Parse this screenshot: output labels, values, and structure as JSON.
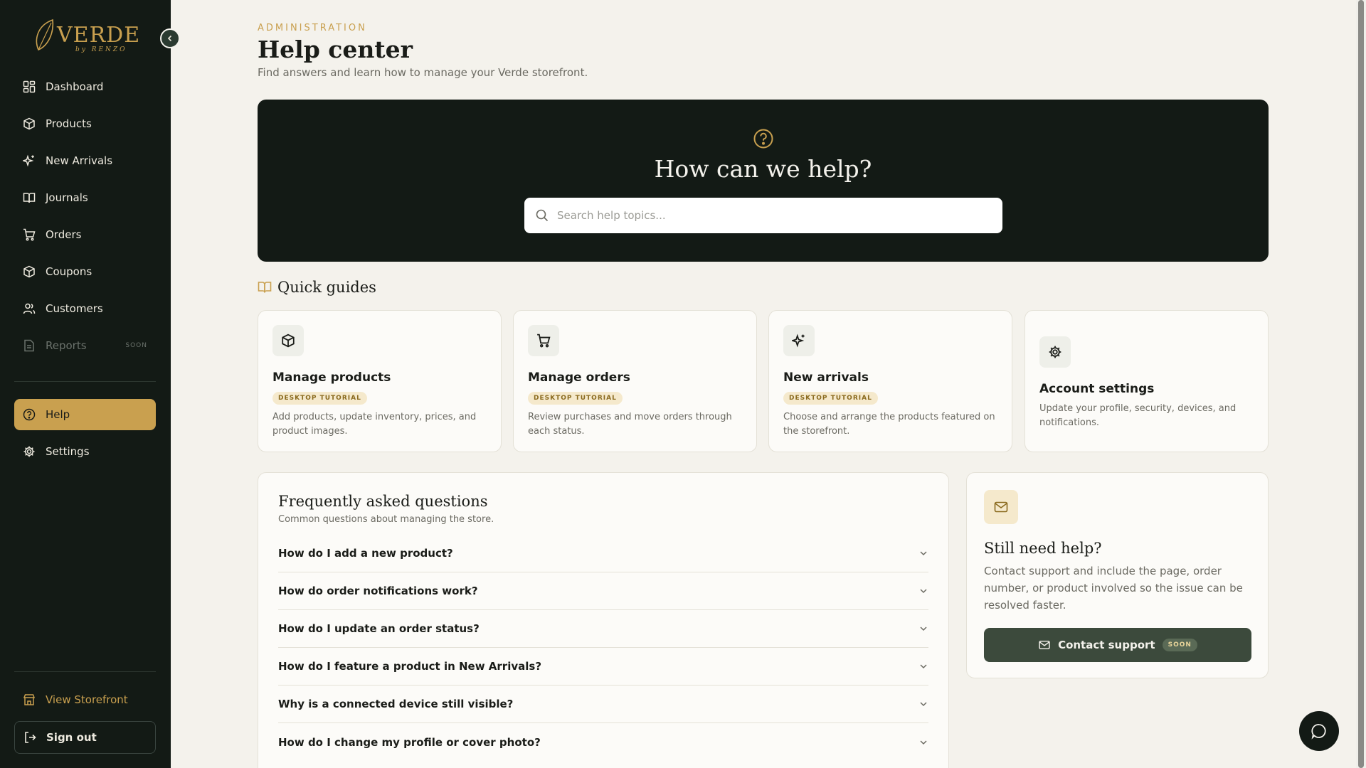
{
  "brand": {
    "name": "VERDE",
    "tagline": "by RENZO",
    "accent": "#c9a04f",
    "dark": "#131a15"
  },
  "sidebar": {
    "items": [
      {
        "label": "Dashboard",
        "icon": "dashboard-icon"
      },
      {
        "label": "Products",
        "icon": "box-icon"
      },
      {
        "label": "New Arrivals",
        "icon": "sparkle-icon"
      },
      {
        "label": "Journals",
        "icon": "book-icon"
      },
      {
        "label": "Orders",
        "icon": "cart-icon"
      },
      {
        "label": "Coupons",
        "icon": "coupon-icon"
      },
      {
        "label": "Customers",
        "icon": "users-icon"
      },
      {
        "label": "Reports",
        "icon": "report-icon",
        "badge": "SOON"
      }
    ],
    "secondary": [
      {
        "label": "Help",
        "icon": "help-icon",
        "active": true
      },
      {
        "label": "Settings",
        "icon": "gear-icon"
      }
    ],
    "view_storefront": "View Storefront",
    "sign_out": "Sign out"
  },
  "header": {
    "eyebrow": "ADMINISTRATION",
    "title": "Help center",
    "subtitle": "Find answers and learn how to manage your Verde storefront."
  },
  "hero": {
    "title": "How can we help?",
    "search_placeholder": "Search help topics..."
  },
  "quick_guides": {
    "title": "Quick guides",
    "cards": [
      {
        "title": "Manage products",
        "badge": "DESKTOP TUTORIAL",
        "desc": "Add products, update inventory, prices, and product images.",
        "icon": "box-icon"
      },
      {
        "title": "Manage orders",
        "badge": "DESKTOP TUTORIAL",
        "desc": "Review purchases and move orders through each status.",
        "icon": "cart-icon"
      },
      {
        "title": "New arrivals",
        "badge": "DESKTOP TUTORIAL",
        "desc": "Choose and arrange the products featured on the storefront.",
        "icon": "sparkle-icon"
      },
      {
        "title": "Account settings",
        "desc": "Update your profile, security, devices, and notifications.",
        "icon": "gear-icon"
      }
    ]
  },
  "faq": {
    "title": "Frequently asked questions",
    "subtitle": "Common questions about managing the store.",
    "items": [
      "How do I add a new product?",
      "How do order notifications work?",
      "How do I update an order status?",
      "How do I feature a product in New Arrivals?",
      "Why is a connected device still visible?",
      "How do I change my profile or cover photo?"
    ]
  },
  "support": {
    "title": "Still need help?",
    "desc": "Contact support and include the page, order number, or product involved so the issue can be resolved faster.",
    "button": "Contact support",
    "badge": "SOON"
  }
}
